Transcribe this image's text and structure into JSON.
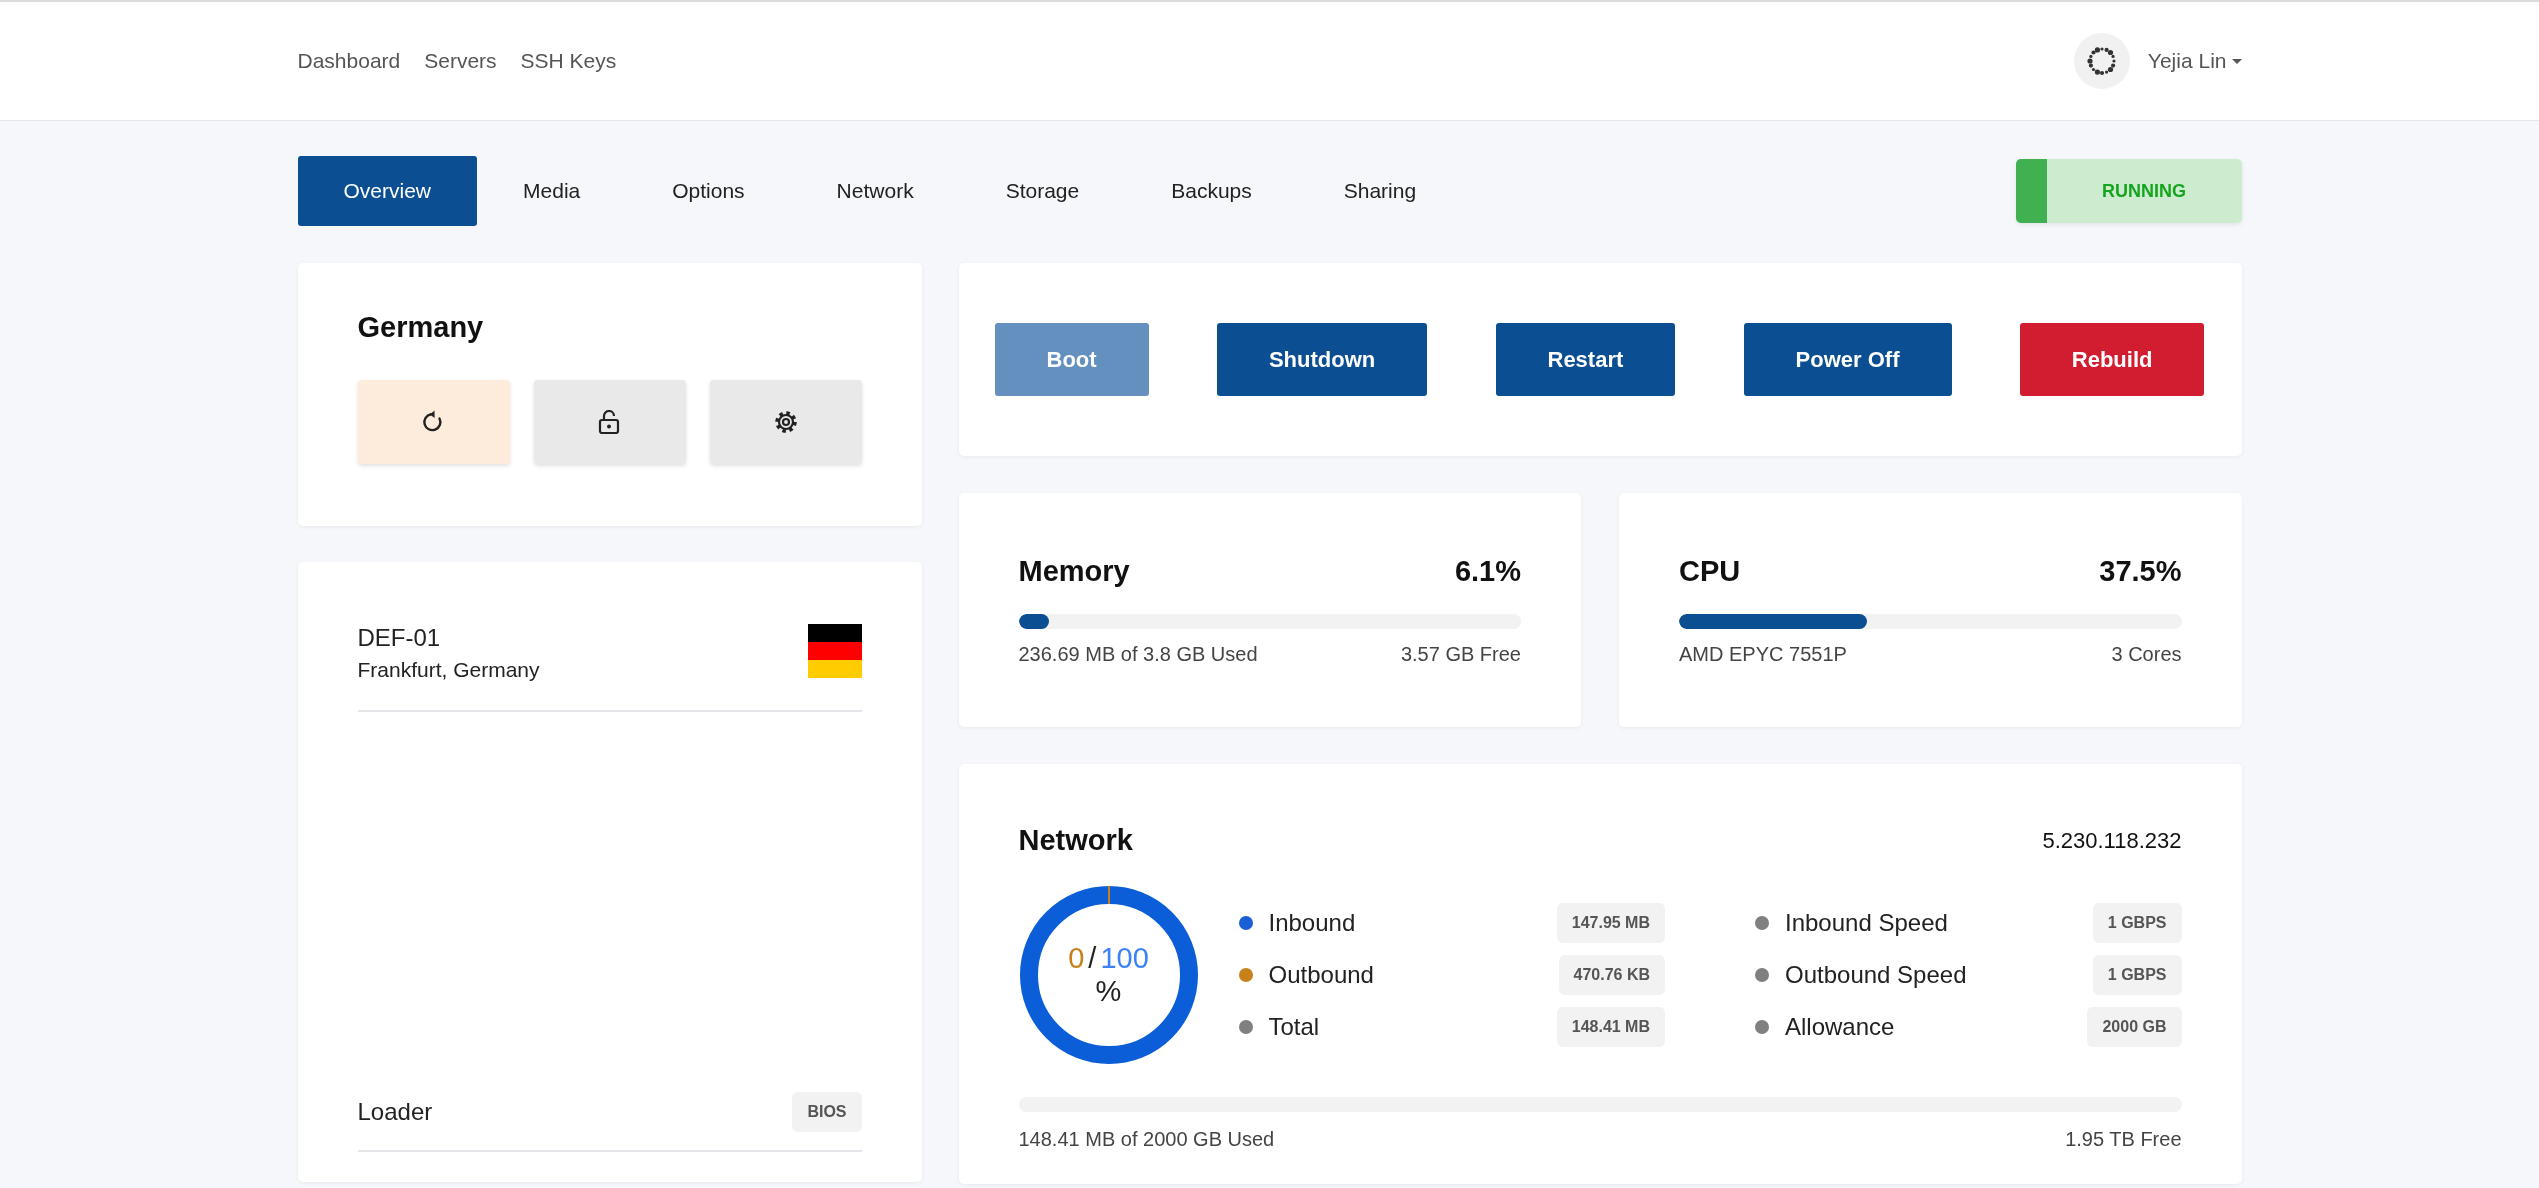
{
  "nav": {
    "links": [
      {
        "label": "Dashboard"
      },
      {
        "label": "Servers"
      },
      {
        "label": "SSH Keys"
      }
    ],
    "user": {
      "name": "Yejia Lin"
    }
  },
  "tabs": [
    {
      "label": "Overview",
      "selected": true
    },
    {
      "label": "Media",
      "selected": false
    },
    {
      "label": "Options",
      "selected": false
    },
    {
      "label": "Network",
      "selected": false
    },
    {
      "label": "Storage",
      "selected": false
    },
    {
      "label": "Backups",
      "selected": false
    },
    {
      "label": "Sharing",
      "selected": false
    }
  ],
  "status": {
    "label": "RUNNING",
    "running": true
  },
  "location_card": {
    "title": "Germany",
    "actions": [
      {
        "kind": "reload"
      },
      {
        "kind": "unlock"
      },
      {
        "kind": "settings"
      }
    ]
  },
  "server_card": {
    "name": "DEF-01",
    "location": "Frankfurt, Germany",
    "rows": [
      {
        "label": "Loader",
        "value": "BIOS"
      }
    ]
  },
  "power_buttons": [
    {
      "label": "Boot",
      "kind": "primary",
      "disabled": true
    },
    {
      "label": "Shutdown",
      "kind": "primary",
      "disabled": false
    },
    {
      "label": "Restart",
      "kind": "primary",
      "disabled": false
    },
    {
      "label": "Power Off",
      "kind": "primary",
      "disabled": false
    },
    {
      "label": "Rebuild",
      "kind": "danger",
      "disabled": false
    }
  ],
  "meters": [
    {
      "title": "Memory",
      "percent": "6.1%",
      "level": 0.061,
      "left": "236.69 MB of 3.8 GB Used",
      "right": "3.57 GB Free"
    },
    {
      "title": "CPU",
      "percent": "37.5%",
      "level": 0.375,
      "left": "AMD EPYC 7551P",
      "right": "3 Cores"
    }
  ],
  "network": {
    "title": "Network",
    "ip": "5.230.118.232",
    "donut": {
      "used": "0",
      "separator": "/",
      "total": "100",
      "unit": "%"
    },
    "traffic": [
      {
        "label": "Inbound",
        "color": "#1a5fd6",
        "value": "147.95 MB"
      },
      {
        "label": "Outbound",
        "color": "#c8801a",
        "value": "470.76 KB"
      },
      {
        "label": "Total",
        "color": "#808080",
        "value": "148.41 MB"
      }
    ],
    "limits": [
      {
        "label": "Inbound Speed",
        "value": "1 GBPS"
      },
      {
        "label": "Outbound Speed",
        "value": "1 GBPS"
      },
      {
        "label": "Allowance",
        "value": "2000 GB"
      }
    ],
    "usage": {
      "level": 0,
      "left": "148.41 MB of 2000 GB Used",
      "right": "1.95 TB Free"
    }
  }
}
